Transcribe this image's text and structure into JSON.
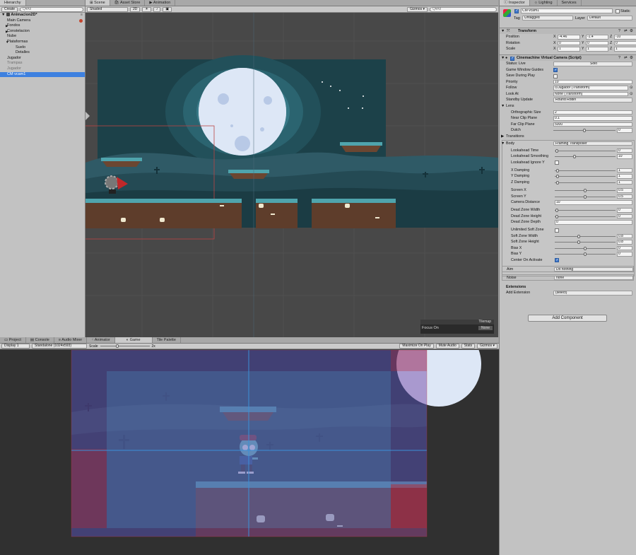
{
  "hierarchy": {
    "tab": "Hierarchy",
    "create": "Create",
    "search_placeholder": "Q▾All",
    "scene": "Animacion2D*",
    "items": [
      {
        "label": "Main Camera",
        "indent": 1
      },
      {
        "label": "Fondos",
        "indent": 1,
        "arrow": "▶"
      },
      {
        "label": "Constelacion",
        "indent": 1,
        "arrow": "▶"
      },
      {
        "label": "Nube",
        "indent": 1
      },
      {
        "label": "Plataformas",
        "indent": 1,
        "arrow": "▼"
      },
      {
        "label": "Suelo",
        "indent": 2
      },
      {
        "label": "Detalles",
        "indent": 2
      },
      {
        "label": "Jugador",
        "indent": 1
      },
      {
        "label": "Trampas",
        "indent": 1,
        "dim": true
      },
      {
        "label": "Jugador",
        "indent": 1,
        "dim": true
      },
      {
        "label": "CM vcam1",
        "indent": 1,
        "selected": true
      }
    ]
  },
  "scene_tabs": [
    "Scene",
    "Asset Store",
    "Animation"
  ],
  "scene_toolbar": {
    "shading": "Shaded",
    "mode2d": "2D",
    "gizmos": "Gizmos ▾",
    "search_placeholder": "Q▾All"
  },
  "tilemap": {
    "title": "Tilemap",
    "focus_label": "Focus On",
    "focus_value": "None"
  },
  "bottom_tabs": [
    "Project",
    "Console",
    "Audio Mixer",
    "Animator",
    "Game",
    "Tile Palette"
  ],
  "game_toolbar": {
    "display": "Display 1",
    "resolution": "Standalone (1024x593)",
    "scale_label": "Scale",
    "scale_value": "2x",
    "buttons": [
      "Maximize On Play",
      "Mute Audio",
      "Stats",
      "Gizmos ▾"
    ]
  },
  "inspector": {
    "tabs": [
      "Inspector",
      "Lighting",
      "Services"
    ],
    "object_name": "CM vcam1",
    "static_label": "Static",
    "tag_label": "Tag",
    "tag_value": "Untagged",
    "layer_label": "Layer",
    "layer_value": "Default",
    "transform": {
      "title": "Transform",
      "position_label": "Position",
      "pos": [
        "-4.46",
        "-1.4",
        "-10"
      ],
      "rotation_label": "Rotation",
      "rot": [
        "0",
        "0",
        "0"
      ],
      "scale_label": "Scale",
      "scl": [
        "1",
        "1",
        "1"
      ],
      "axis": [
        "X",
        "Y",
        "Z"
      ]
    },
    "cinemachine": {
      "title": "Cinemachine Virtual Camera (Script)",
      "status_label": "Status: Live",
      "solo": "Solo",
      "game_window_guides": "Game Window Guides",
      "save_during_play": "Save During Play",
      "priority_label": "Priority",
      "priority": "10",
      "follow_label": "Follow",
      "follow": "⊙Jugador (Transform)",
      "lookat_label": "Look At",
      "lookat": "None (Transform)",
      "standby_label": "Standby Update",
      "standby": "Round Robin",
      "lens": "Lens",
      "ortho_label": "Orthographic Size",
      "ortho": "2",
      "near_label": "Near Clip Plane",
      "near": "0.1",
      "far_label": "Far Clip Plane",
      "far": "5000",
      "dutch_label": "Dutch",
      "dutch": "0",
      "transitions": "Transitions",
      "body_label": "Body",
      "body": "Framing Transposer",
      "lookahead_time_label": "Lookahead Time",
      "lookahead_time": "0",
      "lookahead_smooth_label": "Lookahead Smoothing",
      "lookahead_smooth": "10",
      "lookahead_ignore_label": "Lookahead Ignore Y",
      "xdamp_label": "X Damping",
      "xdamp": "1",
      "ydamp_label": "Y Damping",
      "ydamp": "1",
      "zdamp_label": "Z Damping",
      "zdamp": "1",
      "screenx_label": "Screen X",
      "screenx": "0.5",
      "screeny_label": "Screen Y",
      "screeny": "0.5",
      "camdist_label": "Camera Distance",
      "camdist": "10",
      "dzw_label": "Dead Zone Width",
      "dzw": "0",
      "dzh_label": "Dead Zone Height",
      "dzh": "0",
      "dzd_label": "Dead Zone Depth",
      "dzd": "0",
      "unlimited_label": "Unlimited Soft Zone",
      "szw_label": "Soft Zone Width",
      "szw": "0.8",
      "szh_label": "Soft Zone Height",
      "szh": "0.8",
      "biasx_label": "Bias X",
      "biasx": "0",
      "biasy_label": "Bias Y",
      "biasy": "0",
      "center_label": "Center On Activate",
      "aim_label": "Aim",
      "aim": "Do nothing",
      "noise_label": "Noise",
      "noise": "none",
      "extensions": "Extensions",
      "add_ext_label": "Add Extension",
      "add_ext": "(select)"
    },
    "add_component": "Add Component"
  },
  "colors": {
    "selection": "#3d80df",
    "scene_bg": "#484848",
    "sky": "#1f4650",
    "moon": "#dbe6f5",
    "ground": "#6b4631",
    "grass": "#4fa4ad"
  }
}
